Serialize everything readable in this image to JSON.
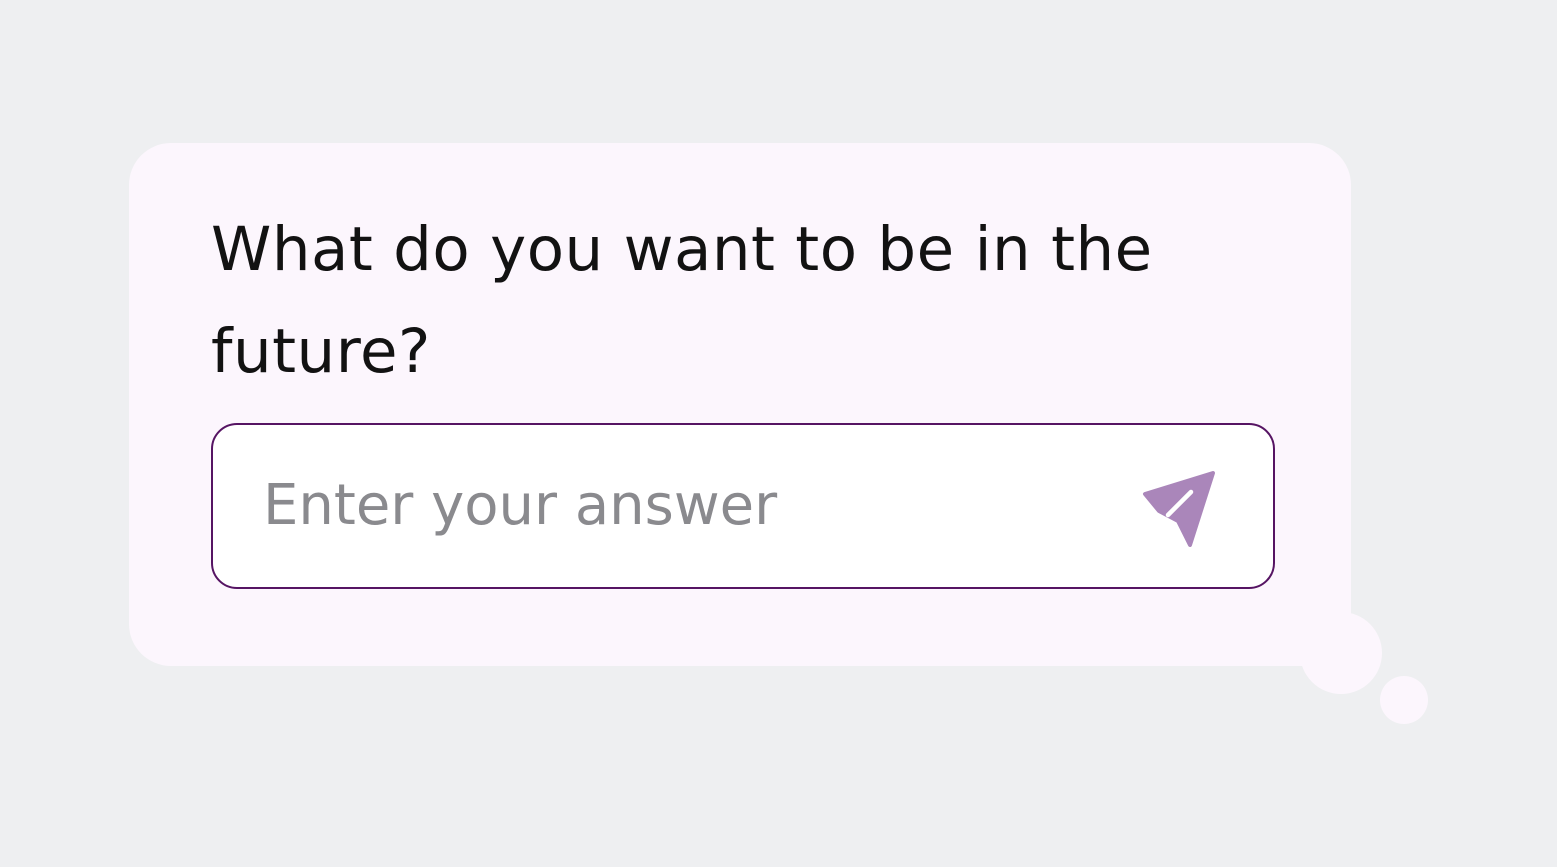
{
  "prompt": {
    "question": "What do you want to be in the future?"
  },
  "answer": {
    "placeholder": "Enter your answer",
    "value": ""
  },
  "send": {
    "icon": "send-icon",
    "icon_color": "#aa86ba"
  },
  "colors": {
    "page_background": "#eeeff1",
    "bubble_background": "#fcf6fd",
    "input_border": "#561463"
  }
}
